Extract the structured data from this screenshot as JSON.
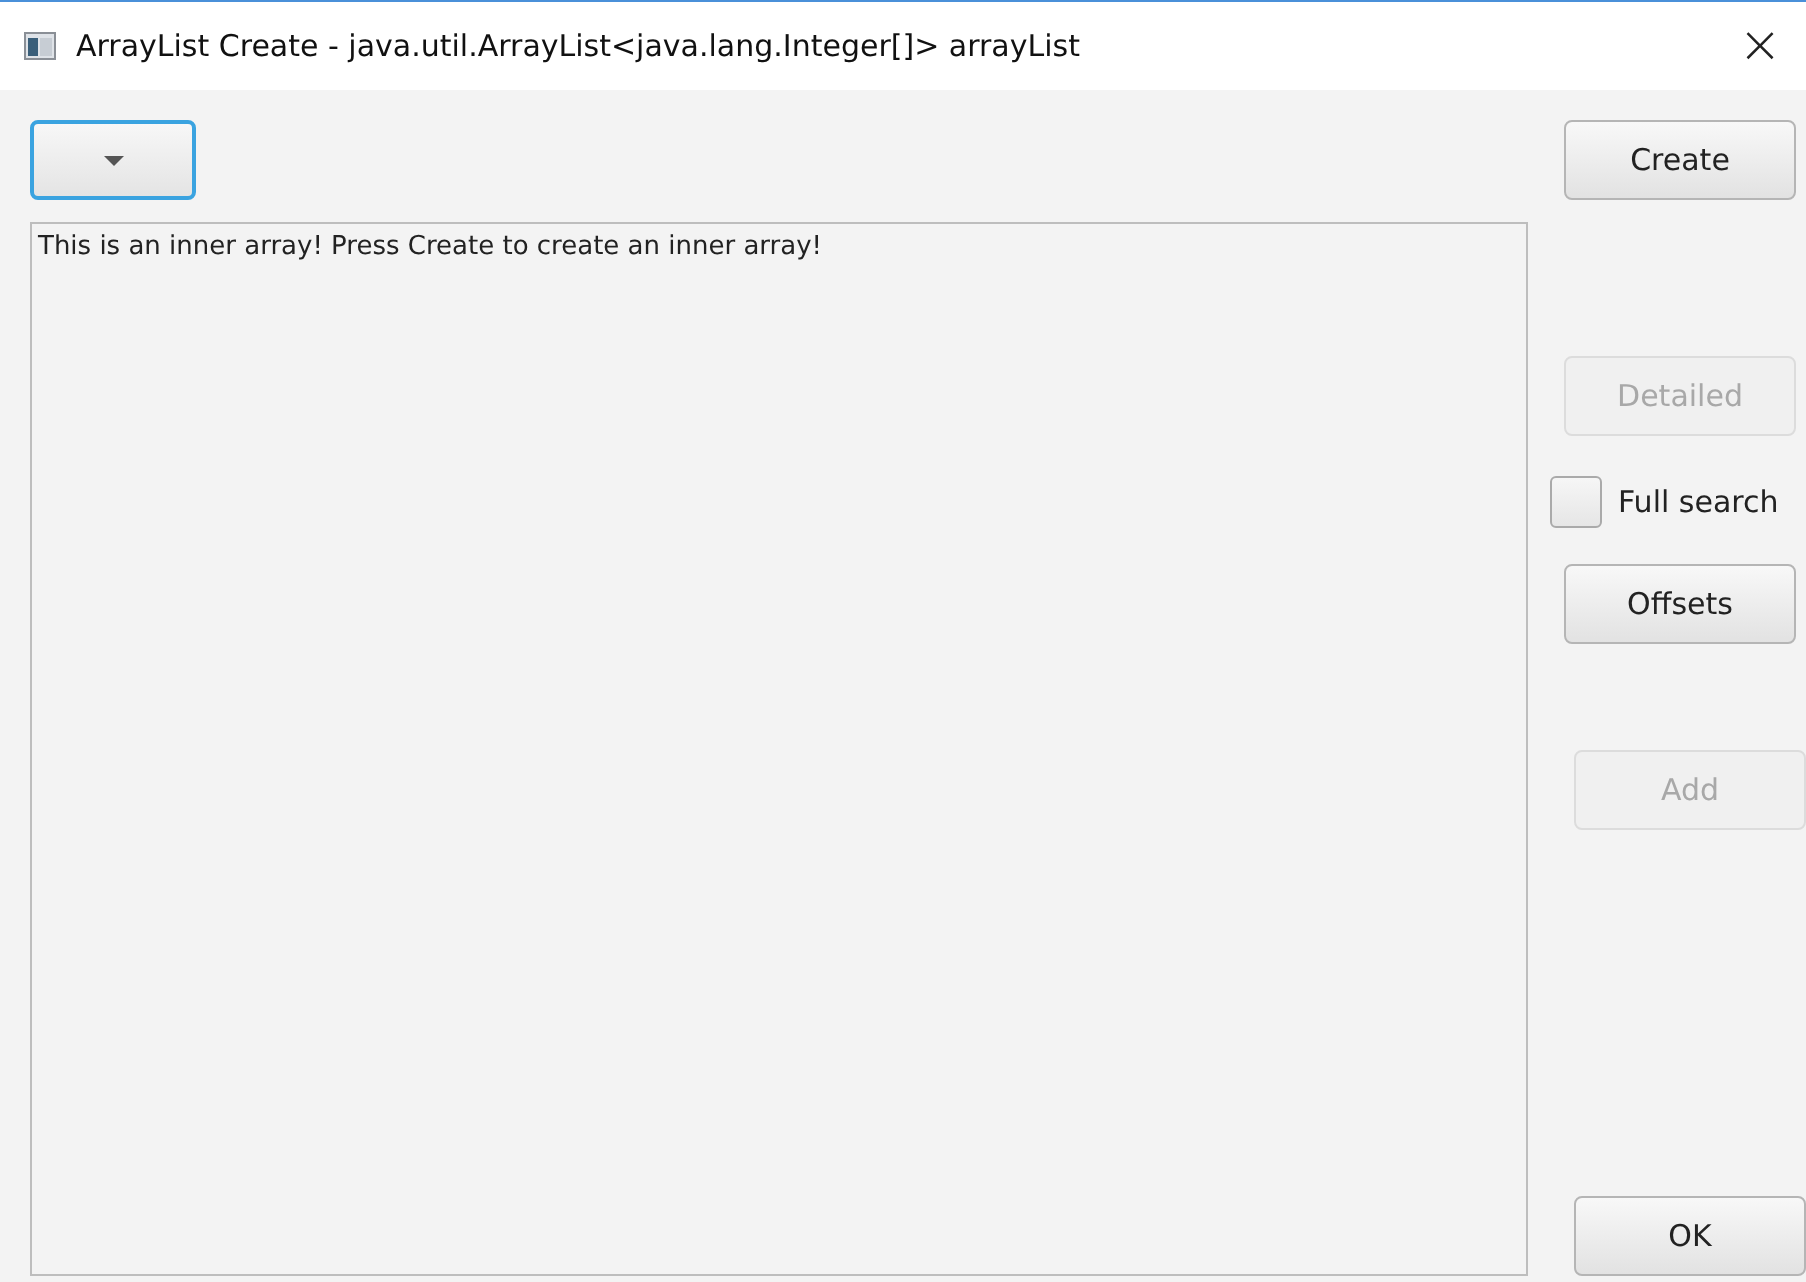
{
  "window": {
    "title": "ArrayList Create - java.util.ArrayList<java.lang.Integer[]> arrayList",
    "close": "×"
  },
  "combo": {
    "focused": true
  },
  "text_area": {
    "value": "This is an inner array! Press Create to create an inner array!"
  },
  "side_controls": [
    {
      "kind": "button",
      "label": "Create",
      "disabled": false
    },
    {
      "kind": "button",
      "label": "Detailed",
      "disabled": true
    },
    {
      "kind": "checkbox",
      "label": "Full search",
      "checked": false
    },
    {
      "kind": "button",
      "label": "Offsets",
      "disabled": false
    },
    {
      "kind": "button",
      "label": "Add",
      "disabled": true
    },
    {
      "kind": "button",
      "label": "OK",
      "disabled": false
    }
  ]
}
